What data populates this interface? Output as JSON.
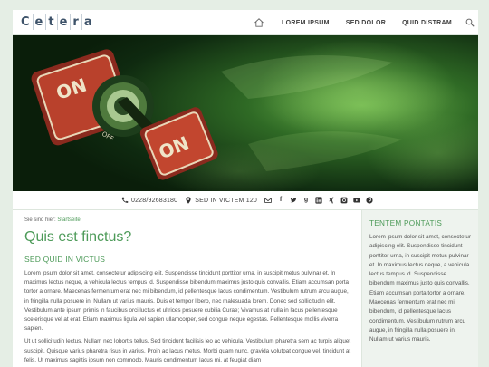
{
  "header": {
    "logo_letters": [
      "C",
      "e",
      "t",
      "e",
      "r",
      "a"
    ],
    "nav": [
      "LOREM IPSUM",
      "SED DOLOR",
      "QUID DISTRAM"
    ]
  },
  "hero": {
    "switch_label_top": "ON",
    "switch_label_main": "ON",
    "switch_label_off": "OFF"
  },
  "contact": {
    "phone": "0228/92683180",
    "location": "SED IN VICTEM 120",
    "social_icons": [
      "mail-icon",
      "facebook-icon",
      "twitter-icon",
      "googleplus-icon",
      "skype-icon",
      "linkedin-icon",
      "xing-icon",
      "instagram-icon",
      "youtube-icon",
      "pinterest-icon"
    ]
  },
  "breadcrumb": {
    "prefix": "Sie sind hier:",
    "link": "Startseite"
  },
  "main": {
    "title": "Quis est finctus?",
    "subtitle": "SED QUID IN VICTUS",
    "paragraphs": [
      "Lorem ipsum dolor sit amet, consectetur adipiscing elit. Suspendisse tincidunt porttitor urna, in suscipit metus pulvinar et. In maximus lectus neque, a vehicula lectus tempus id. Suspendisse bibendum maximus justo quis convallis. Etiam accumsan porta tortor a ornare. Maecenas fermentum erat nec mi bibendum, id pellentesque lacus condimentum. Vestibulum rutrum arcu augue, in fringilla nulla posuere in. Nullam ut varius mauris. Duis et tempor libero, nec malesuada lorem. Donec sed sollicitudin elit. Vestibulum ante ipsum primis in faucibus orci luctus et ultrices posuere cubilia Curae; Vivamus at nulla in lacus pellentesque scelerisque vel at erat. Etiam maximus ligula vel sapien ullamcorper, sed congue neque egestas. Pellentesque mollis viverra sapien.",
      "Ut ut sollicitudin lectus. Nullam nec lobortis tellus. Sed tincidunt facilisis leo ac vehicula. Vestibulum pharetra sem ac turpis aliquet suscipit. Quisque varius pharetra risus in varius. Proin ac lacus metus. Morbi quam nunc, gravida volutpat congue vel, tincidunt at felis. Ut maximus sagittis ipsum non commodo. Mauris condimentum lacus mi, at feugiat diam"
    ]
  },
  "sidebar": {
    "title": "TENTEM PONTATIS",
    "text": "Lorem ipsum dolor sit amet, consectetur adipiscing elit. Suspendisse tincidunt porttitor urna, in suscipit metus pulvinar et. In maximus lectus neque, a vehicula lectus tempus id. Suspendisse bibendum maximus justo quis convallis. Etiam accumsan porta tortor a ornare. Maecenas fermentum erat nec mi bibendum, id pellentesque lacus condimentum. Vestibulum rutrum arcu augue, in fringilla nulla posuere in. Nullam ut varius mauris."
  },
  "colors": {
    "accent_green": "#4c9a58",
    "logo_blue": "#3d5269",
    "background": "#e5eee5",
    "sidebar_bg": "#eef3ee"
  }
}
